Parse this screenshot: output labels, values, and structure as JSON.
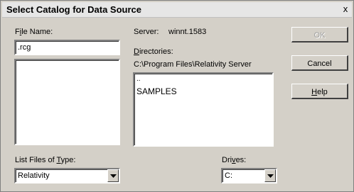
{
  "window": {
    "title": "Select Catalog for Data Source",
    "close_label": "x"
  },
  "file_name": {
    "label_pre": "F",
    "label_accel": "i",
    "label_post": "le Name:",
    "value": ".rcg",
    "list_items": []
  },
  "server": {
    "label": "Server:",
    "value": "winnt.1583"
  },
  "directories": {
    "label_accel": "D",
    "label_post": "irectories:",
    "path": "C:\\Program Files\\Relativity Server",
    "items": [
      "..",
      "SAMPLES"
    ]
  },
  "file_type": {
    "label_pre": "List Files of ",
    "label_accel": "T",
    "label_post": "ype:",
    "selected": "Relativity"
  },
  "drives": {
    "label_pre": "Dri",
    "label_accel": "v",
    "label_post": "es:",
    "selected": "C:"
  },
  "buttons": {
    "ok": "OK",
    "cancel": "Cancel",
    "help_accel": "H",
    "help_post": "elp"
  }
}
